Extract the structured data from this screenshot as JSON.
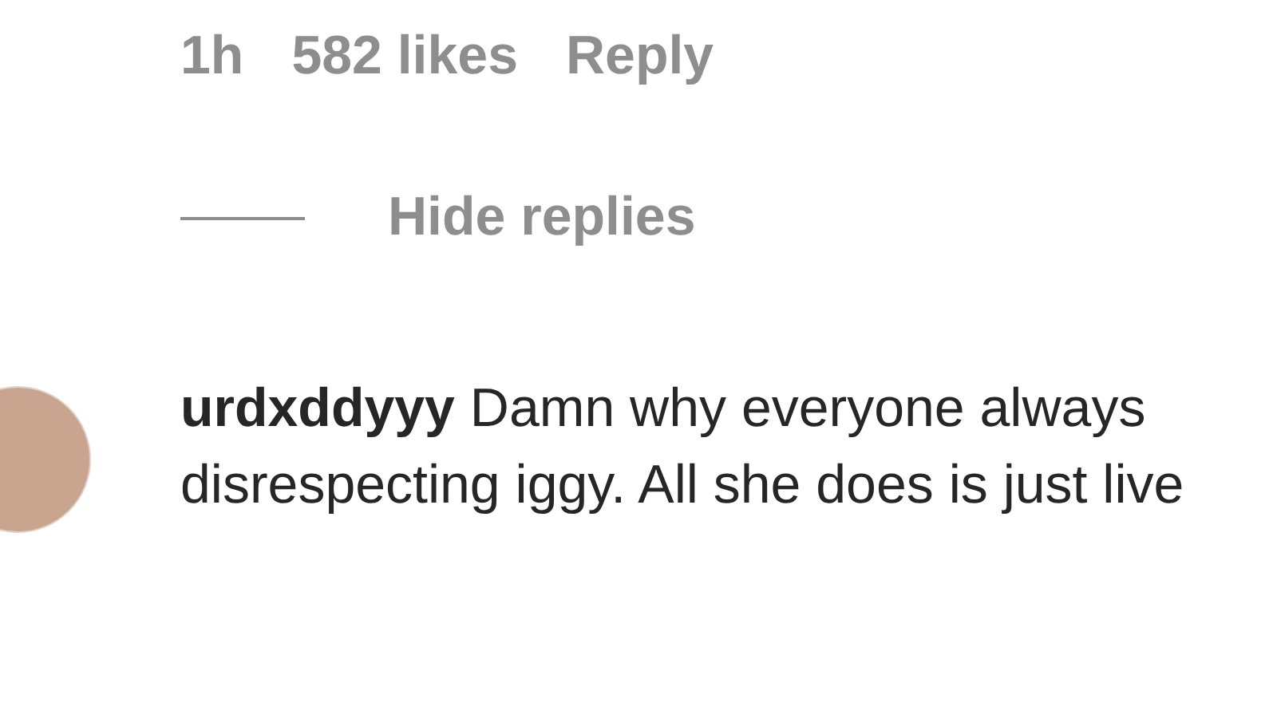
{
  "reply_meta": {
    "time": "1h",
    "likes": "582 likes",
    "reply": "Reply"
  },
  "replies_toggle": {
    "label": "Hide replies"
  },
  "comment": {
    "username": "urdxddyyy",
    "text": "Damn why everyone always disrespecting iggy. All she does is just live"
  }
}
